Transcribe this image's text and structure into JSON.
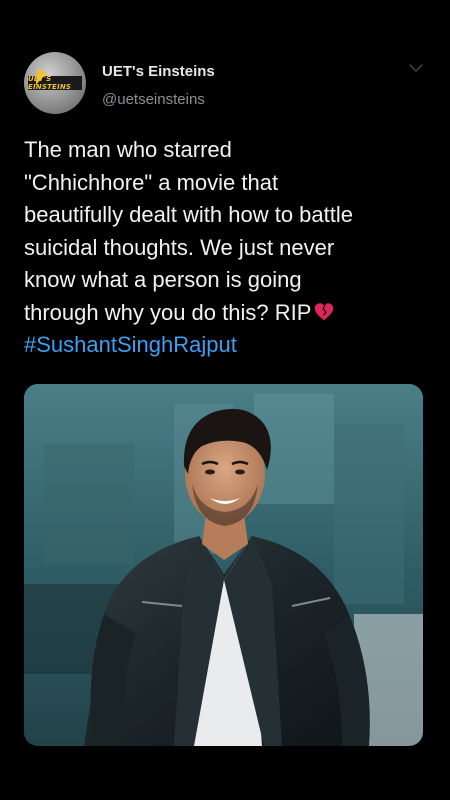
{
  "tweet": {
    "author": {
      "display_name": "UET's Einsteins",
      "handle": "@uetseinsteins",
      "avatar_logo_text": "UET'S EINSTEINS"
    },
    "text_lines": [
      "The man who starred",
      "\"Chhichhore\" a movie that",
      "beautifully dealt with how to battle",
      "suicidal thoughts. We just never",
      "know what a person is going",
      "through why you do this? RIP"
    ],
    "hashtag": "#SushantSinghRajput",
    "emoji": "broken-heart-icon",
    "photo": {
      "subject": "smiling man in black leather jacket over white t-shirt"
    }
  },
  "colors": {
    "background": "#000000",
    "text": "#f2f2f2",
    "handle": "#8b8f94",
    "hashtag": "#3aa0f2",
    "heart": "#e0245e"
  }
}
